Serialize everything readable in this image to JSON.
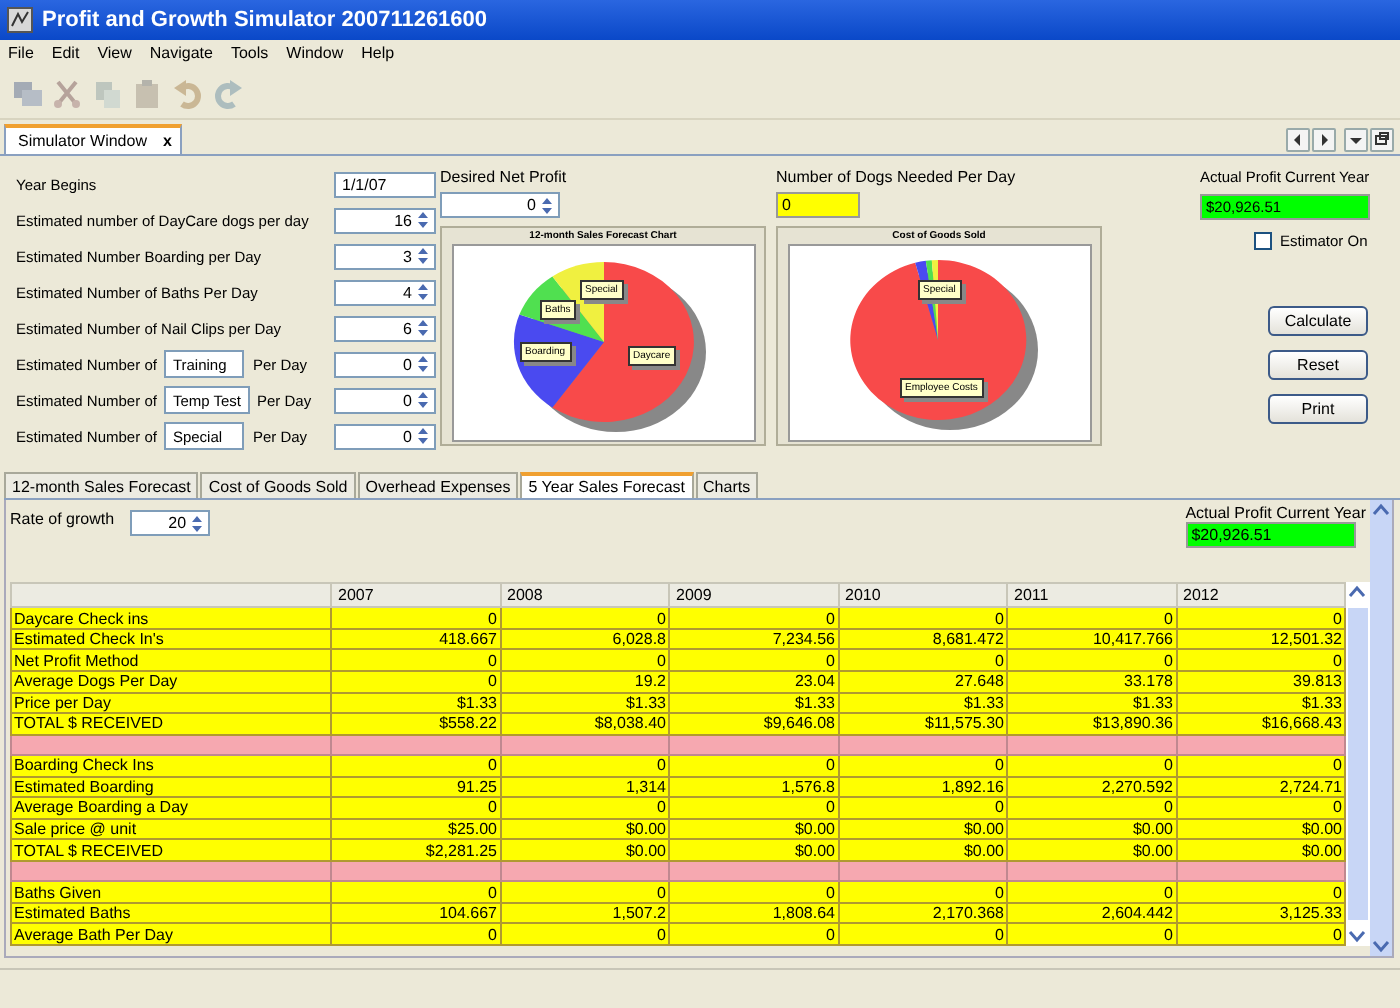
{
  "window": {
    "title": "Profit and Growth Simulator 200711261600"
  },
  "menu": [
    "File",
    "Edit",
    "View",
    "Navigate",
    "Tools",
    "Window",
    "Help"
  ],
  "toolbar": [
    {
      "kind": "windows",
      "disabled": true
    },
    {
      "kind": "cut",
      "disabled": true
    },
    {
      "kind": "copy",
      "disabled": true
    },
    {
      "kind": "paste",
      "disabled": true
    },
    {
      "kind": "undo",
      "disabled": true
    },
    {
      "kind": "redo",
      "disabled": true
    }
  ],
  "doc_tab": {
    "label": "Simulator Window",
    "close": "x",
    "selected": true
  },
  "year_begins": {
    "label": "Year Begins",
    "value": "1/1/07"
  },
  "estimates": [
    {
      "kind": "plain",
      "label": "Estimated number of DayCare dogs per day",
      "value": "16"
    },
    {
      "kind": "plain",
      "label": "Estimated Number Boarding per Day",
      "value": "3"
    },
    {
      "kind": "plain",
      "label": "Estimated Number of Baths Per Day",
      "value": "4"
    },
    {
      "kind": "plain",
      "label": "Estimated Number of Nail Clips per Day",
      "value": "6"
    },
    {
      "kind": "custom",
      "prefix": "Estimated Number of",
      "name": "Training",
      "suffix": "Per Day",
      "value": "0"
    },
    {
      "kind": "custom",
      "prefix": "Estimated Number of",
      "name": "Temp Test",
      "suffix": "Per Day",
      "value": "0"
    },
    {
      "kind": "custom",
      "prefix": "Estimated Number of",
      "name": "Special",
      "suffix": "Per Day",
      "value": "0"
    }
  ],
  "desired_net_profit": {
    "label": "Desired Net Profit",
    "value": "0"
  },
  "dogs_needed": {
    "label": "Number of Dogs Needed Per Day",
    "value": "0"
  },
  "actual_profit": {
    "label": "Actual Profit Current Year",
    "value": "$20,926.51"
  },
  "estimator": {
    "label": "Estimator On",
    "checked": false
  },
  "charts": [
    {
      "title": "12-month Sales Forecast Chart",
      "labels": [
        "Special",
        "Baths",
        "Boarding",
        "Daycare"
      ]
    },
    {
      "title": "Cost of Goods Sold",
      "labels": [
        "Special",
        "Employee Costs"
      ]
    }
  ],
  "buttons": [
    "Calculate",
    "Reset",
    "Print"
  ],
  "tabs": [
    {
      "label": "12-month Sales Forecast",
      "selected": false
    },
    {
      "label": "Cost of Goods Sold",
      "selected": false
    },
    {
      "label": "Overhead Expenses",
      "selected": false
    },
    {
      "label": "5 Year Sales Forecast",
      "selected": true
    },
    {
      "label": "Charts",
      "selected": false
    }
  ],
  "rate_of_growth": {
    "label": "Rate of growth",
    "value": "20"
  },
  "actual_profit_2": {
    "label": "Actual Profit Current Year",
    "value": "$20,926.51"
  },
  "table": {
    "columns": [
      "2007",
      "2008",
      "2009",
      "2010",
      "2011",
      "2012"
    ],
    "rows": [
      {
        "kind": "data",
        "label": "Daycare Check ins",
        "cells": [
          "0",
          "0",
          "0",
          "0",
          "0",
          "0"
        ]
      },
      {
        "kind": "data",
        "label": "Estimated Check In's",
        "cells": [
          "418.667",
          "6,028.8",
          "7,234.56",
          "8,681.472",
          "10,417.766",
          "12,501.32"
        ]
      },
      {
        "kind": "data",
        "label": "Net Profit Method",
        "cells": [
          "0",
          "0",
          "0",
          "0",
          "0",
          "0"
        ]
      },
      {
        "kind": "data",
        "label": "Average Dogs Per Day",
        "cells": [
          "0",
          "19.2",
          "23.04",
          "27.648",
          "33.178",
          "39.813"
        ]
      },
      {
        "kind": "data",
        "label": "Price per Day",
        "cells": [
          "$1.33",
          "$1.33",
          "$1.33",
          "$1.33",
          "$1.33",
          "$1.33"
        ]
      },
      {
        "kind": "data",
        "label": "TOTAL $ RECEIVED",
        "cells": [
          "$558.22",
          "$8,038.40",
          "$9,646.08",
          "$11,575.30",
          "$13,890.36",
          "$16,668.43"
        ]
      },
      {
        "kind": "separator"
      },
      {
        "kind": "data",
        "label": "Boarding Check Ins",
        "cells": [
          "0",
          "0",
          "0",
          "0",
          "0",
          "0"
        ]
      },
      {
        "kind": "data",
        "label": "Estimated Boarding",
        "cells": [
          "91.25",
          "1,314",
          "1,576.8",
          "1,892.16",
          "2,270.592",
          "2,724.71"
        ]
      },
      {
        "kind": "data",
        "label": "Average Boarding a Day",
        "cells": [
          "0",
          "0",
          "0",
          "0",
          "0",
          "0"
        ]
      },
      {
        "kind": "data",
        "label": "Sale price @ unit",
        "cells": [
          "$25.00",
          "$0.00",
          "$0.00",
          "$0.00",
          "$0.00",
          "$0.00"
        ]
      },
      {
        "kind": "data",
        "label": "TOTAL $ RECEIVED",
        "cells": [
          "$2,281.25",
          "$0.00",
          "$0.00",
          "$0.00",
          "$0.00",
          "$0.00"
        ]
      },
      {
        "kind": "separator"
      },
      {
        "kind": "data",
        "label": "Baths Given",
        "cells": [
          "0",
          "0",
          "0",
          "0",
          "0",
          "0"
        ]
      },
      {
        "kind": "data",
        "label": "Estimated Baths",
        "cells": [
          "104.667",
          "1,507.2",
          "1,808.64",
          "2,170.368",
          "2,604.442",
          "3,125.33"
        ]
      },
      {
        "kind": "data",
        "label": "Average Bath Per Day",
        "cells": [
          "0",
          "0",
          "0",
          "0",
          "0",
          "0"
        ]
      }
    ]
  }
}
